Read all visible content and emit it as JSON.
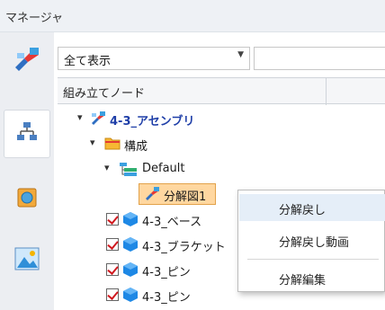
{
  "panel": {
    "title": "マネージャ"
  },
  "filter": {
    "selected": "全て表示"
  },
  "column_header": "組み立てノード",
  "tree": {
    "assembly": "4-3_アセンブリ",
    "config_folder": "構成",
    "config_default": "Default",
    "explode_view": "分解図1",
    "parts": [
      "4-3_ベース",
      "4-3_ブラケット",
      "4-3_ピン",
      "4-3_ピン"
    ]
  },
  "context_menu": {
    "items": [
      "分解戻し",
      "分解戻し動画",
      "分解編集"
    ]
  },
  "icons": [
    "manager-filter-icon",
    "assembly-tree-tab-icon",
    "part-tab-icon",
    "scene-tab-icon",
    "assembly-icon",
    "folder-icon",
    "configuration-icon",
    "explode-view-icon",
    "part-icon"
  ],
  "colors": {
    "assembly_text": "#1f3fa8",
    "selection": "#ffd7a0",
    "check": "#d0191f"
  }
}
